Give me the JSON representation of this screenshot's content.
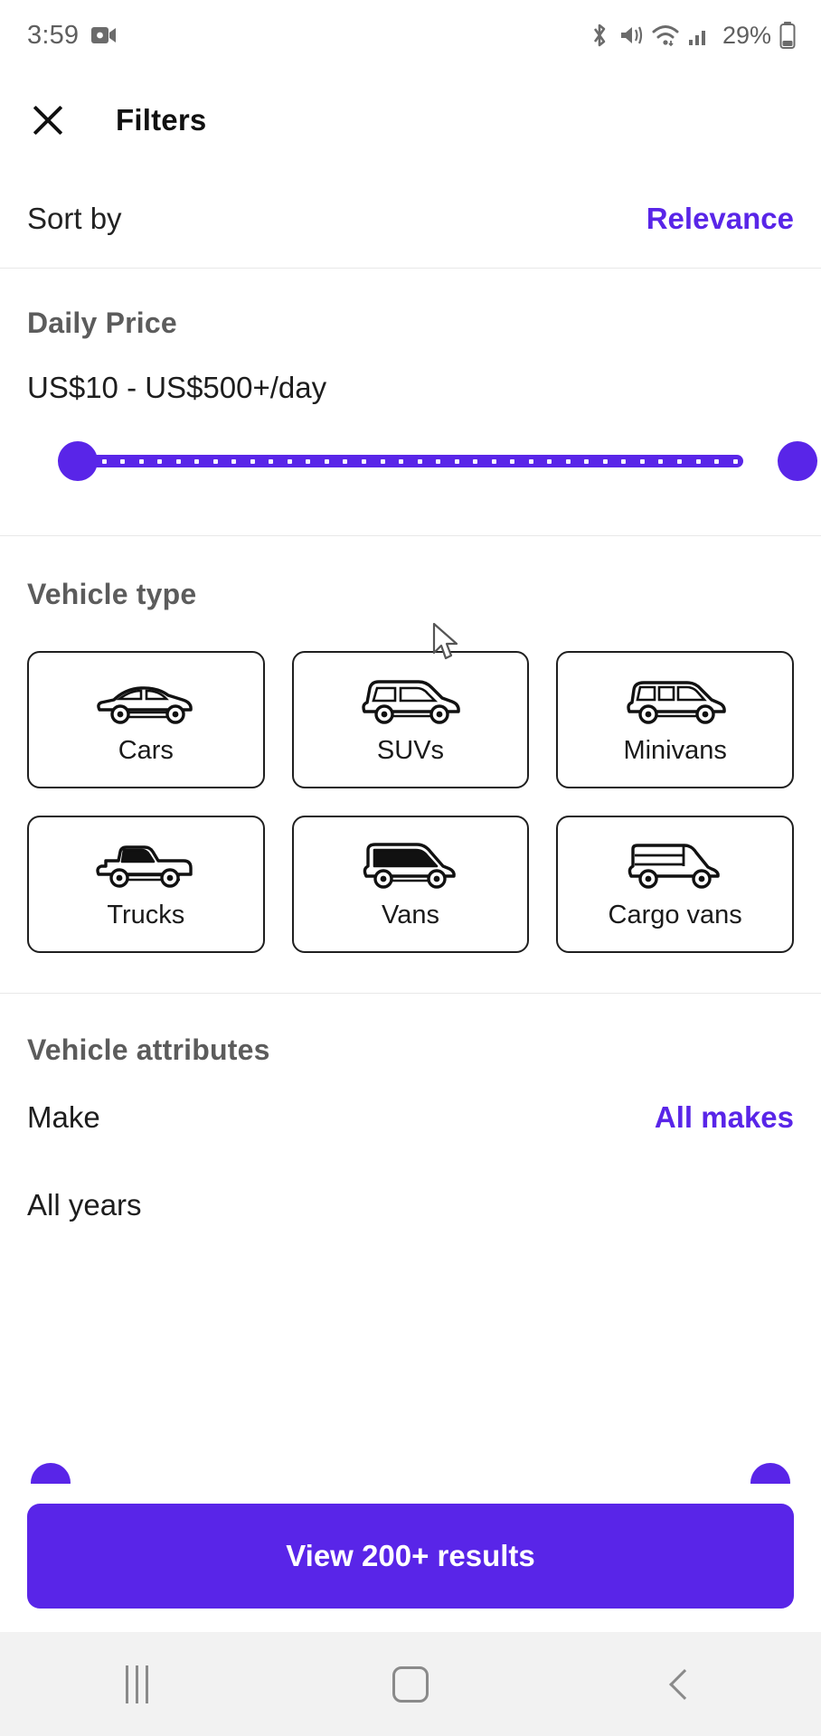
{
  "status_bar": {
    "time": "3:59",
    "battery_percent": "29%",
    "icons": [
      "video-camera-icon",
      "bluetooth-icon",
      "vibrate-icon",
      "wifi-icon",
      "cellular-signal-icon",
      "battery-icon"
    ]
  },
  "header": {
    "title": "Filters",
    "close_icon": "close-icon"
  },
  "sort": {
    "label": "Sort by",
    "value": "Relevance"
  },
  "daily_price": {
    "heading": "Daily Price",
    "range_text": "US$10 - US$500+/day",
    "min_label": "US$10",
    "max_label": "US$500+",
    "slider": {
      "left_percent": 0,
      "right_percent": 100,
      "tick_count": 36
    }
  },
  "vehicle_type": {
    "heading": "Vehicle type",
    "options": [
      {
        "label": "Cars",
        "icon": "sedan-icon",
        "selected": false
      },
      {
        "label": "SUVs",
        "icon": "suv-icon",
        "selected": false
      },
      {
        "label": "Minivans",
        "icon": "minivan-icon",
        "selected": false
      },
      {
        "label": "Trucks",
        "icon": "pickup-truck-icon",
        "selected": false
      },
      {
        "label": "Vans",
        "icon": "van-icon",
        "selected": false
      },
      {
        "label": "Cargo vans",
        "icon": "cargo-van-icon",
        "selected": false
      }
    ]
  },
  "vehicle_attributes": {
    "heading": "Vehicle attributes",
    "make": {
      "label": "Make",
      "value": "All makes"
    },
    "years": {
      "label": "All years"
    }
  },
  "footer": {
    "cta_label": "View 200+ results"
  },
  "nav_bar": {
    "recents": "recents-icon",
    "home": "home-icon",
    "back": "back-icon"
  },
  "colors": {
    "accent": "#5925E8",
    "heading_gray": "#5c5c5c",
    "text": "#1d1d1d",
    "divider": "#e8e8e8",
    "navbar_bg": "#f2f2f2"
  }
}
